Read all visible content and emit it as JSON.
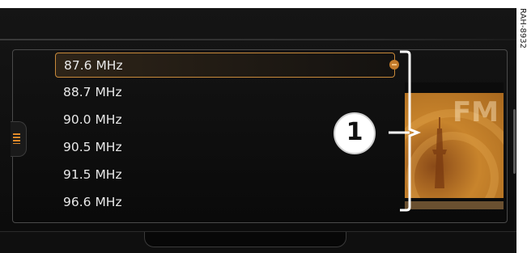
{
  "stations": [
    {
      "frequency": "87.6 MHz",
      "selected": true
    },
    {
      "frequency": "88.7 MHz",
      "selected": false
    },
    {
      "frequency": "90.0 MHz",
      "selected": false
    },
    {
      "frequency": "90.5 MHz",
      "selected": false
    },
    {
      "frequency": "91.5 MHz",
      "selected": false
    },
    {
      "frequency": "96.6 MHz",
      "selected": false
    }
  ],
  "album_art": {
    "band_label": "FM",
    "icon": "radio-tower-icon"
  },
  "callout": {
    "number": "1"
  },
  "figure_code": "RAH-8932",
  "colors": {
    "accent": "#c98a3a",
    "text": "#e8e8e8",
    "background": "#0b0b0b"
  }
}
